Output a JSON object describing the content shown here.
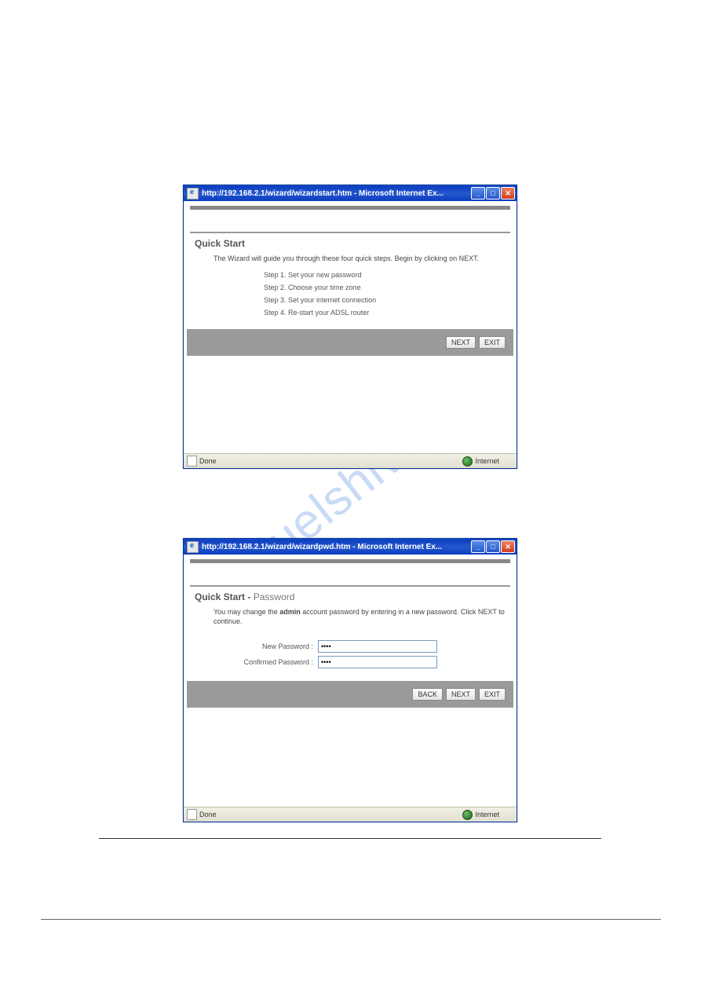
{
  "watermark": "manuelshive.com",
  "window1": {
    "title": "http://192.168.2.1/wizard/wizardstart.htm - Microsoft Internet Ex...",
    "section_title": "Quick Start",
    "intro": "The Wizard will guide you through these four quick steps. Begin by clicking on NEXT.",
    "steps": [
      "Step 1. Set your new password",
      "Step 2. Choose your time zone",
      "Step 3. Set your internet connection",
      "Step 4. Re-start your ADSL router"
    ],
    "buttons": {
      "next": "NEXT",
      "exit": "EXIT"
    },
    "status_left": "Done",
    "status_right": "Internet"
  },
  "window2": {
    "title": "http://192.168.2.1/wizard/wizardpwd.htm - Microsoft Internet Ex...",
    "section_title_main": "Quick Start - ",
    "section_title_sub": "Password",
    "intro_pre": "You may change the ",
    "intro_bold": "admin",
    "intro_post": " account password by entering in a new password. Click NEXT to continue.",
    "labels": {
      "new_pwd": "New Password :",
      "confirm_pwd": "Confirmed Password :"
    },
    "values": {
      "new_pwd": "••••",
      "confirm_pwd": "••••"
    },
    "buttons": {
      "back": "BACK",
      "next": "NEXT",
      "exit": "EXIT"
    },
    "status_left": "Done",
    "status_right": "Internet"
  }
}
